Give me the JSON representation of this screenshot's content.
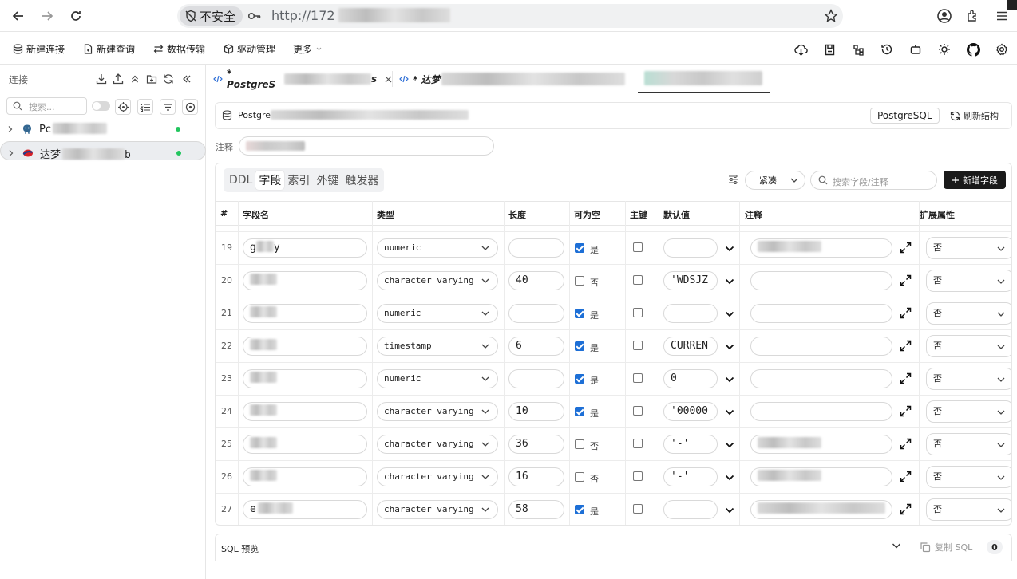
{
  "browser": {
    "insecure_label": "不安全",
    "url_visible": "http://172"
  },
  "toolbar": {
    "new_connection": "新建连接",
    "new_query": "新建查询",
    "data_transfer": "数据传输",
    "driver_manage": "驱动管理",
    "more": "更多"
  },
  "sidebar": {
    "title": "连接",
    "search_placeholder": "搜索...",
    "connections": [
      {
        "label": "Pc",
        "icon": "postgresql-icon",
        "status_color": "#22c55e"
      },
      {
        "label": "达梦",
        "label_tail": "b",
        "icon": "dameng-icon",
        "status_color": "#22c55e"
      }
    ]
  },
  "tabs": [
    {
      "label": "* PostgreS",
      "tail": "s"
    },
    {
      "label": "* 达梦"
    },
    {
      "label": ""
    }
  ],
  "structure": {
    "conn_name": "Postgre",
    "db_badge": "PostgreSQL",
    "refresh_label": "刷新结构",
    "comment_label": "注释"
  },
  "panel": {
    "subtabs": [
      "DDL",
      "字段",
      "索引",
      "外键",
      "触发器"
    ],
    "active_subtab": "字段",
    "density": "紧凑",
    "search_placeholder": "搜索字段/注释",
    "add_field": "新增字段"
  },
  "table": {
    "headers": [
      "#",
      "字段名",
      "类型",
      "长度",
      "可为空",
      "主键",
      "默认值",
      "注释",
      "扩展属性"
    ],
    "rows": [
      {
        "n": "19",
        "name": "g",
        "name_tail": "y",
        "type": "numeric",
        "length": "",
        "nullable": true,
        "nullable_label": "是",
        "pk": false,
        "default": "",
        "comment_blur": true,
        "ext": "否"
      },
      {
        "n": "20",
        "name": "",
        "type": "character varying",
        "length": "40",
        "nullable": false,
        "nullable_label": "否",
        "pk": false,
        "default": "'WDSJZ",
        "comment_blur": false,
        "ext": "否"
      },
      {
        "n": "21",
        "name": "",
        "type": "numeric",
        "length": "",
        "nullable": true,
        "nullable_label": "是",
        "pk": false,
        "default": "",
        "comment_blur": false,
        "ext": "否"
      },
      {
        "n": "22",
        "name": "",
        "type": "timestamp",
        "length": "6",
        "nullable": true,
        "nullable_label": "是",
        "pk": false,
        "default": "CURREN",
        "comment_blur": false,
        "ext": "否"
      },
      {
        "n": "23",
        "name": "",
        "type": "numeric",
        "length": "",
        "nullable": true,
        "nullable_label": "是",
        "pk": false,
        "default": "0",
        "comment_blur": false,
        "ext": "否"
      },
      {
        "n": "24",
        "name": "",
        "type": "character varying",
        "length": "10",
        "nullable": true,
        "nullable_label": "是",
        "pk": false,
        "default": "'00000",
        "comment_blur": false,
        "ext": "否"
      },
      {
        "n": "25",
        "name": "",
        "type": "character varying",
        "length": "36",
        "nullable": false,
        "nullable_label": "否",
        "pk": false,
        "default": "'-'",
        "comment_blur": true,
        "ext": "否"
      },
      {
        "n": "26",
        "name": "",
        "type": "character varying",
        "length": "16",
        "nullable": false,
        "nullable_label": "否",
        "pk": false,
        "default": "'-'",
        "comment_blur": true,
        "ext": "否"
      },
      {
        "n": "27",
        "name": "e",
        "type": "character varying",
        "length": "58",
        "nullable": true,
        "nullable_label": "是",
        "pk": false,
        "default": "",
        "comment_blur": true,
        "ext": "否"
      }
    ]
  },
  "sql": {
    "label": "SQL 预览",
    "copy_label": "复制 SQL",
    "count": "0"
  }
}
